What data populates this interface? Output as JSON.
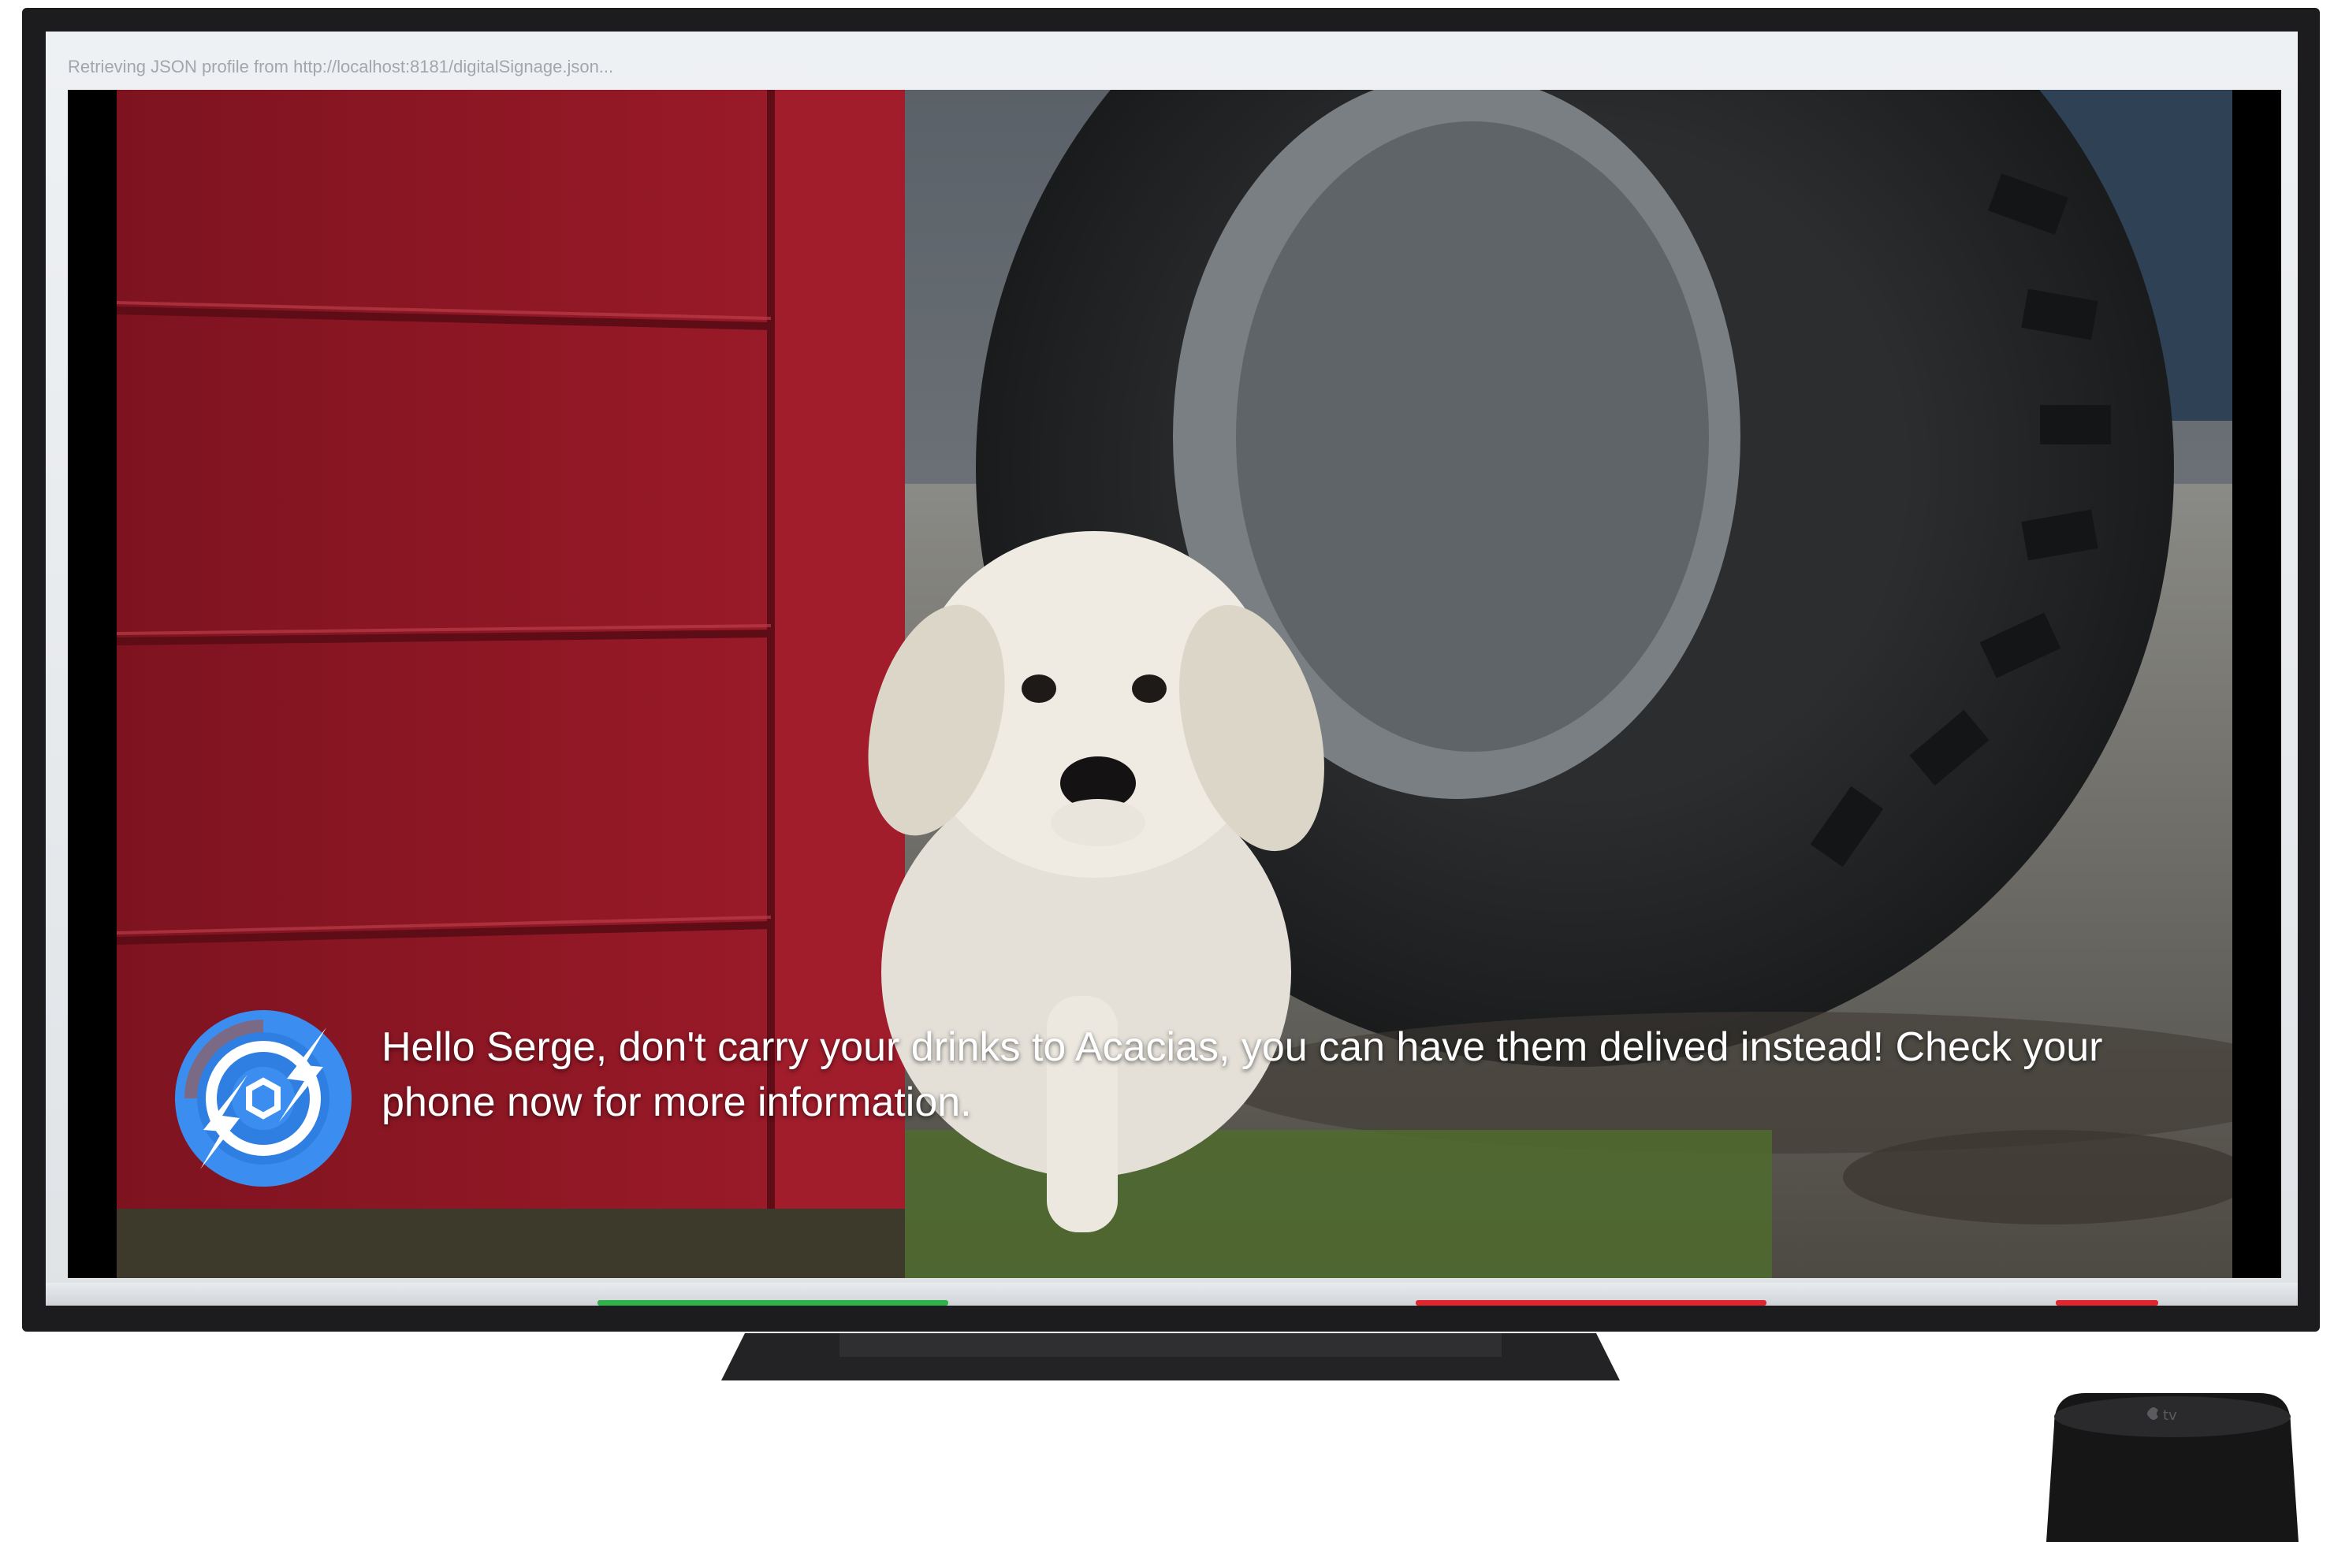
{
  "screen": {
    "status_text": "Retrieving JSON profile from http://localhost:8181/digitalSignage.json..."
  },
  "notification": {
    "message": "Hello Serge, don't carry your drinks to Acacias, you can have them delived instead! Check your phone now for more information."
  },
  "icons": {
    "brand_logo": "lightning-circle-logo-icon",
    "device_logo": "apple-tv-logo-icon"
  },
  "colors": {
    "bezel": "#1c1c1e",
    "logo_blue": "#3b8ef0",
    "logo_ring": "#7a6a86",
    "barn_red": "#8f1522",
    "strip_green": "#2fb24a",
    "strip_red": "#e0262f"
  }
}
